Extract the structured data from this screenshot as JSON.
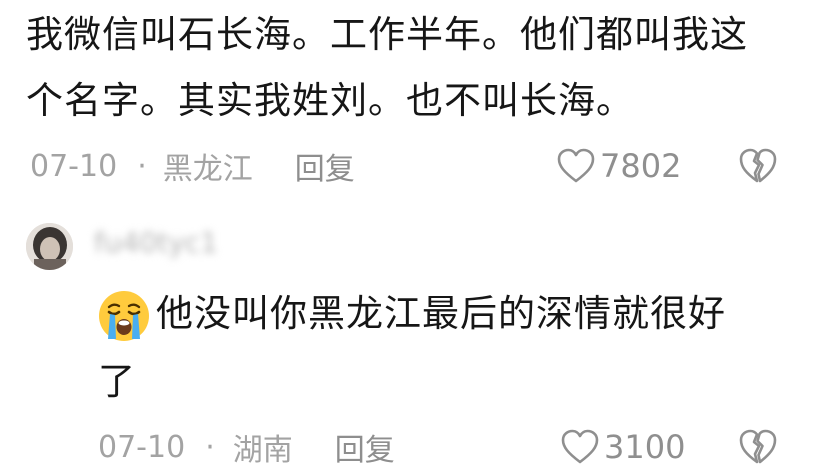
{
  "comment1": {
    "line1": "我微信叫石长海。工作半年。他们都叫我这",
    "line2": "个名字。其实我姓刘。也不叫长海。",
    "date": "07-10",
    "separator": "·",
    "location": "黑龙江",
    "reply_label": "回复",
    "like_icon": "heart-outline-icon",
    "like_count": "7802",
    "dislike_icon": "broken-heart-icon"
  },
  "comment2": {
    "username": "fu40tyc1",
    "emoji": "loudly-crying-face-emoji",
    "line1": "他没叫你黑龙江最后的深情就很好",
    "line2": "了",
    "date": "07-10",
    "separator": "·",
    "location": "湖南",
    "reply_label": "回复",
    "like_icon": "heart-outline-icon",
    "like_count": "3100",
    "dislike_icon": "broken-heart-icon"
  },
  "colors": {
    "text": "#161616",
    "meta": "#a3a3a3",
    "icon": "#8f8f8f",
    "background": "#ffffff"
  }
}
